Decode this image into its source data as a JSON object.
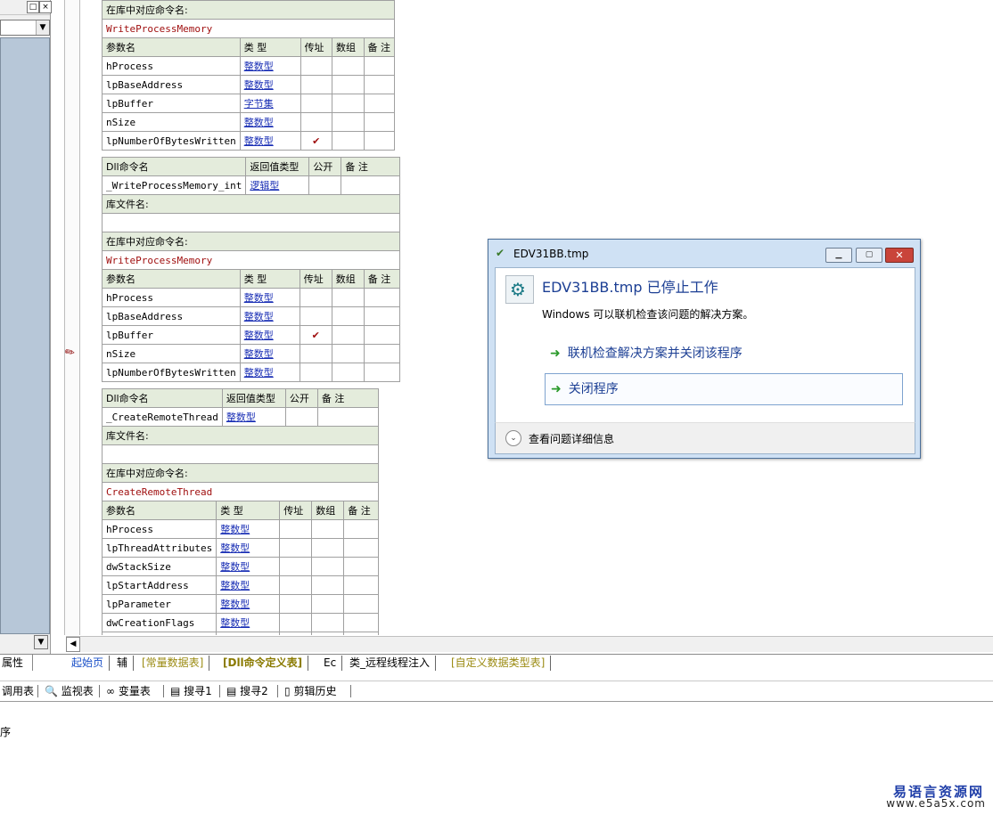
{
  "left_panel": {
    "props_tab": "属性"
  },
  "tables": {
    "t1": {
      "lib_cmd_label": "在库中对应命令名:",
      "lib_cmd_value": "WriteProcessMemory",
      "param_headers": [
        "参数名",
        "类 型",
        "传址",
        "数组",
        "备 注"
      ],
      "params": [
        {
          "name": "hProcess",
          "type": "整数型",
          "byref": ""
        },
        {
          "name": "lpBaseAddress",
          "type": "整数型",
          "byref": ""
        },
        {
          "name": "lpBuffer",
          "type": "字节集",
          "byref": ""
        },
        {
          "name": "nSize",
          "type": "整数型",
          "byref": ""
        },
        {
          "name": "lpNumberOfBytesWritten",
          "type": "整数型",
          "byref": "✔"
        }
      ]
    },
    "t2": {
      "dll_headers": [
        "Dll命令名",
        "返回值类型",
        "公开",
        "备 注"
      ],
      "dll_name": "_WriteProcessMemory_int",
      "dll_return": "逻辑型",
      "lib_file_label": "库文件名:",
      "lib_cmd_label": "在库中对应命令名:",
      "lib_cmd_value": "WriteProcessMemory",
      "param_headers": [
        "参数名",
        "类 型",
        "传址",
        "数组",
        "备 注"
      ],
      "params": [
        {
          "name": "hProcess",
          "type": "整数型",
          "byref": ""
        },
        {
          "name": "lpBaseAddress",
          "type": "整数型",
          "byref": ""
        },
        {
          "name": "lpBuffer",
          "type": "整数型",
          "byref": "✔"
        },
        {
          "name": "nSize",
          "type": "整数型",
          "byref": ""
        },
        {
          "name": "lpNumberOfBytesWritten",
          "type": "整数型",
          "byref": ""
        }
      ]
    },
    "t3": {
      "dll_headers": [
        "Dll命令名",
        "返回值类型",
        "公开",
        "备 注"
      ],
      "dll_name": "_CreateRemoteThread",
      "dll_return": "整数型",
      "lib_file_label": "库文件名:",
      "lib_cmd_label": "在库中对应命令名:",
      "lib_cmd_value": "CreateRemoteThread",
      "param_headers": [
        "参数名",
        "类 型",
        "传址",
        "数组",
        "备 注"
      ],
      "params": [
        {
          "name": "hProcess",
          "type": "整数型"
        },
        {
          "name": "lpThreadAttributes",
          "type": "整数型"
        },
        {
          "name": "dwStackSize",
          "type": "整数型"
        },
        {
          "name": "lpStartAddress",
          "type": "整数型"
        },
        {
          "name": "lpParameter",
          "type": "整数型"
        },
        {
          "name": "dwCreationFlags",
          "type": "整数型"
        },
        {
          "name": "",
          "type": "整数型"
        }
      ]
    }
  },
  "tabs": [
    "起始页",
    "辅",
    "[常量数据表]",
    "[Dll命令定义表]",
    "Ec",
    "类_远程线程注入",
    "[自定义数据类型表]"
  ],
  "toolbar": [
    "调用表",
    "监视表",
    "变量表",
    "搜寻1",
    "搜寻2",
    "剪辑历史"
  ],
  "output_text": "序",
  "dialog": {
    "title": "EDV31BB.tmp",
    "heading": "EDV31BB.tmp 已停止工作",
    "subtext": "Windows 可以联机检查该问题的解决方案。",
    "option_online": "联机检查解决方案并关闭该程序",
    "option_close": "关闭程序",
    "details": "查看问题详细信息"
  },
  "watermark": {
    "line1": "易语言资源网",
    "line2": "www.e5a5x.com"
  }
}
